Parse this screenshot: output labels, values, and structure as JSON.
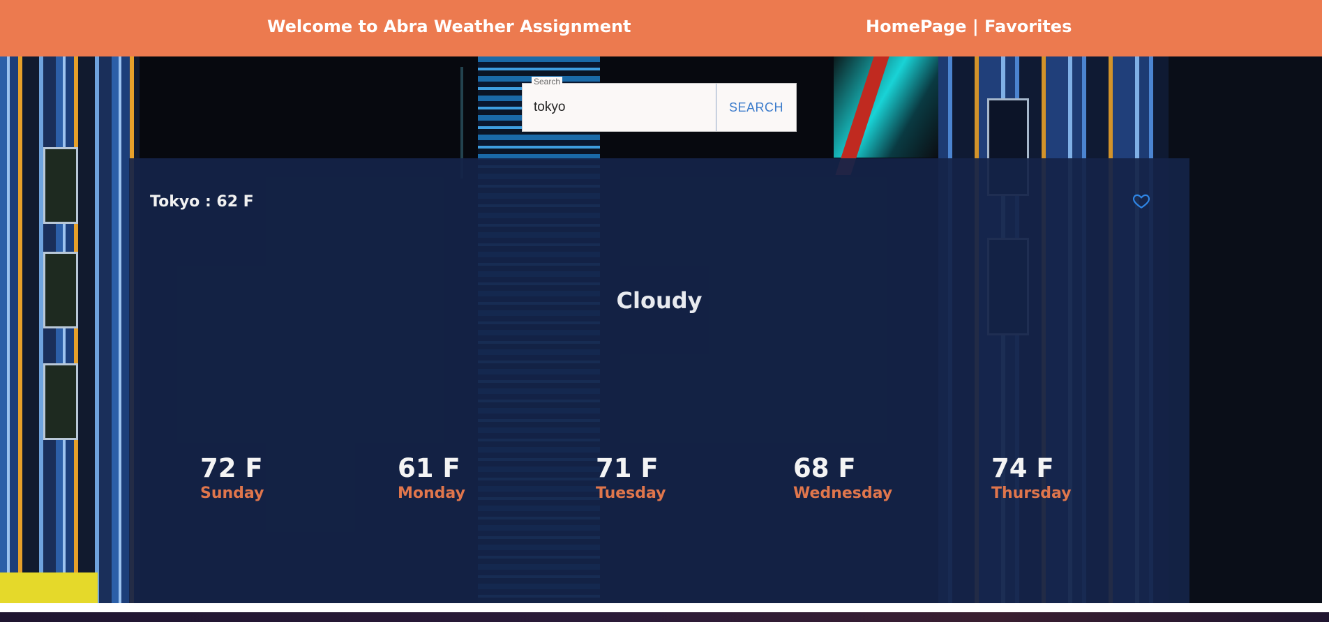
{
  "header": {
    "welcome": "Welcome to Abra Weather Assignment",
    "nav_home": "HomePage",
    "nav_separator": " | ",
    "nav_favorites": "Favorites",
    "background_color": "#ec7a4f"
  },
  "search": {
    "label": "Search",
    "value": "tokyo",
    "button_label": "SEARCH",
    "button_color": "#3b7bcb"
  },
  "current": {
    "city_temp": "Tokyo : 62 F",
    "condition": "Cloudy",
    "favorite_icon": "heart-outline-icon"
  },
  "forecast": [
    {
      "temp": "72 F",
      "day": "Sunday"
    },
    {
      "temp": "61 F",
      "day": "Monday"
    },
    {
      "temp": "71 F",
      "day": "Tuesday"
    },
    {
      "temp": "68 F",
      "day": "Wednesday"
    },
    {
      "temp": "74 F",
      "day": "Thursday"
    }
  ],
  "colors": {
    "panel": "#142448",
    "day_label": "#e0764c",
    "heart": "#2f86e6"
  }
}
